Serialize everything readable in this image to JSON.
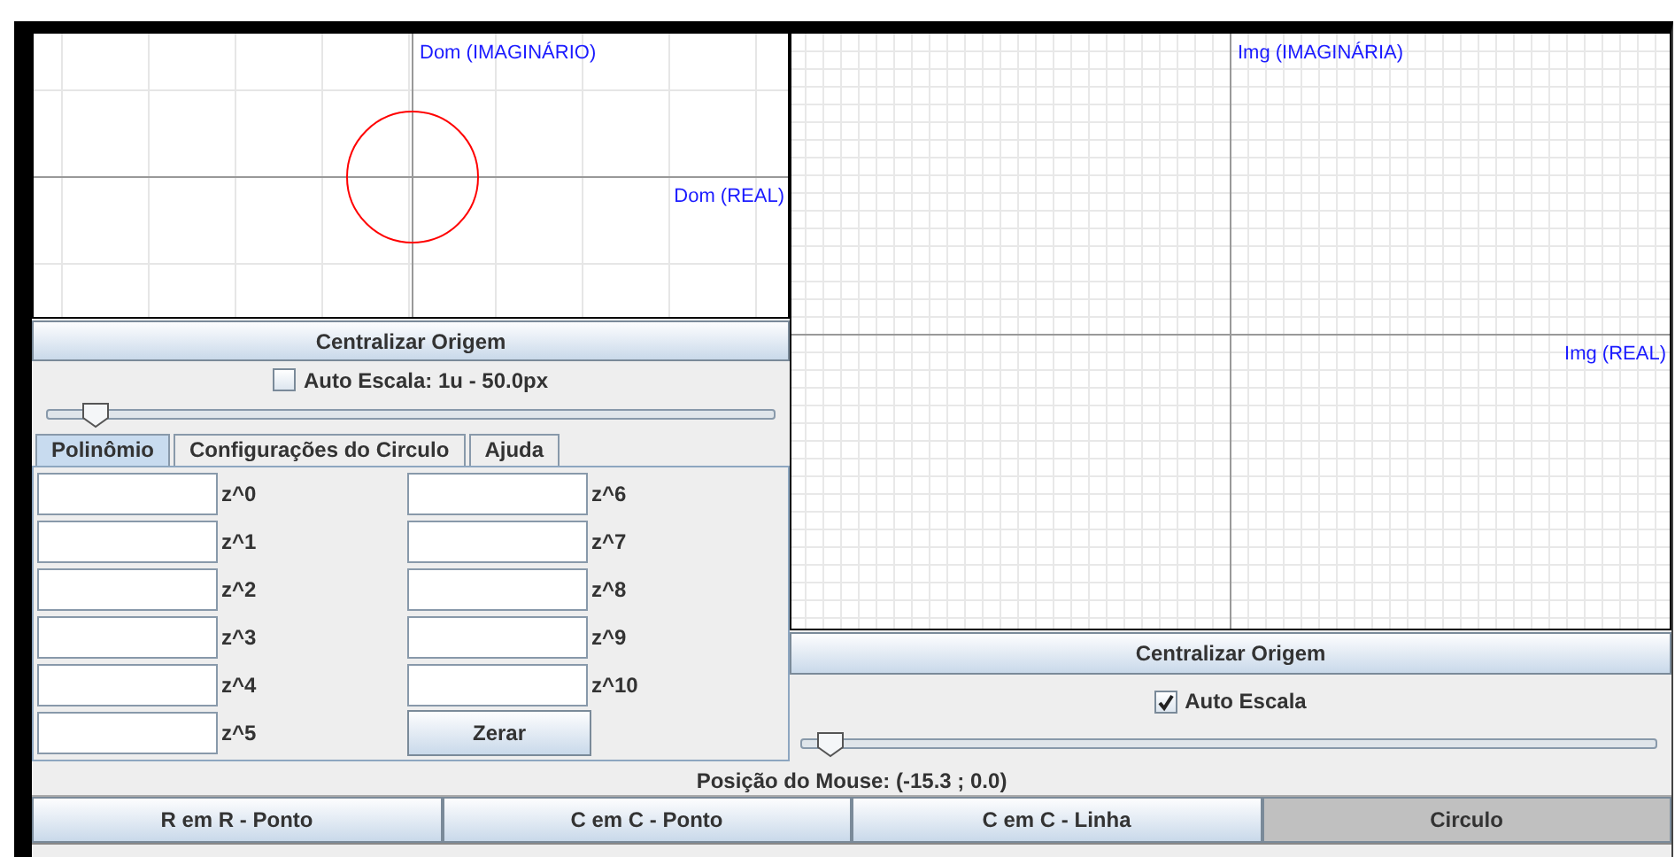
{
  "domain_plot": {
    "imag_label": "Dom (IMAGINÁRIO)",
    "real_label": "Dom (REAL)"
  },
  "domain_center_button": "Centralizar Origem",
  "domain_auto_scale": {
    "label": "Auto Escala: 1u - 50.0px",
    "checked": false
  },
  "domain_zoom_slider": {
    "level": 0.05
  },
  "tabs": [
    {
      "label": "Polinômio",
      "selected": true
    },
    {
      "label": "Configurações do Circulo",
      "selected": false
    },
    {
      "label": "Ajuda",
      "selected": false
    }
  ],
  "coefficients": [
    {
      "label": "z^0"
    },
    {
      "label": "z^1"
    },
    {
      "label": "z^2"
    },
    {
      "label": "z^3"
    },
    {
      "label": "z^4"
    },
    {
      "label": "z^5"
    },
    {
      "label": "z^6"
    },
    {
      "label": "z^7"
    },
    {
      "label": "z^8"
    },
    {
      "label": "z^9"
    },
    {
      "label": "z^10"
    }
  ],
  "clear_button": "Zerar",
  "image_plot": {
    "imag_label": "Img (IMAGINÁRIA)",
    "real_label": "Img (REAL)"
  },
  "image_center_button": "Centralizar Origem",
  "image_auto_scale": {
    "label": "Auto Escala",
    "checked": true
  },
  "image_zoom_slider": {
    "level": 0.02
  },
  "mouse_position": "Posição do Mouse: (-15.3 ; 0.0)",
  "modes": [
    {
      "label": "R em R - Ponto",
      "selected": false
    },
    {
      "label": "C em C - Ponto",
      "selected": false
    },
    {
      "label": "C em C - Linha",
      "selected": false
    },
    {
      "label": "Circulo",
      "selected": true
    }
  ]
}
